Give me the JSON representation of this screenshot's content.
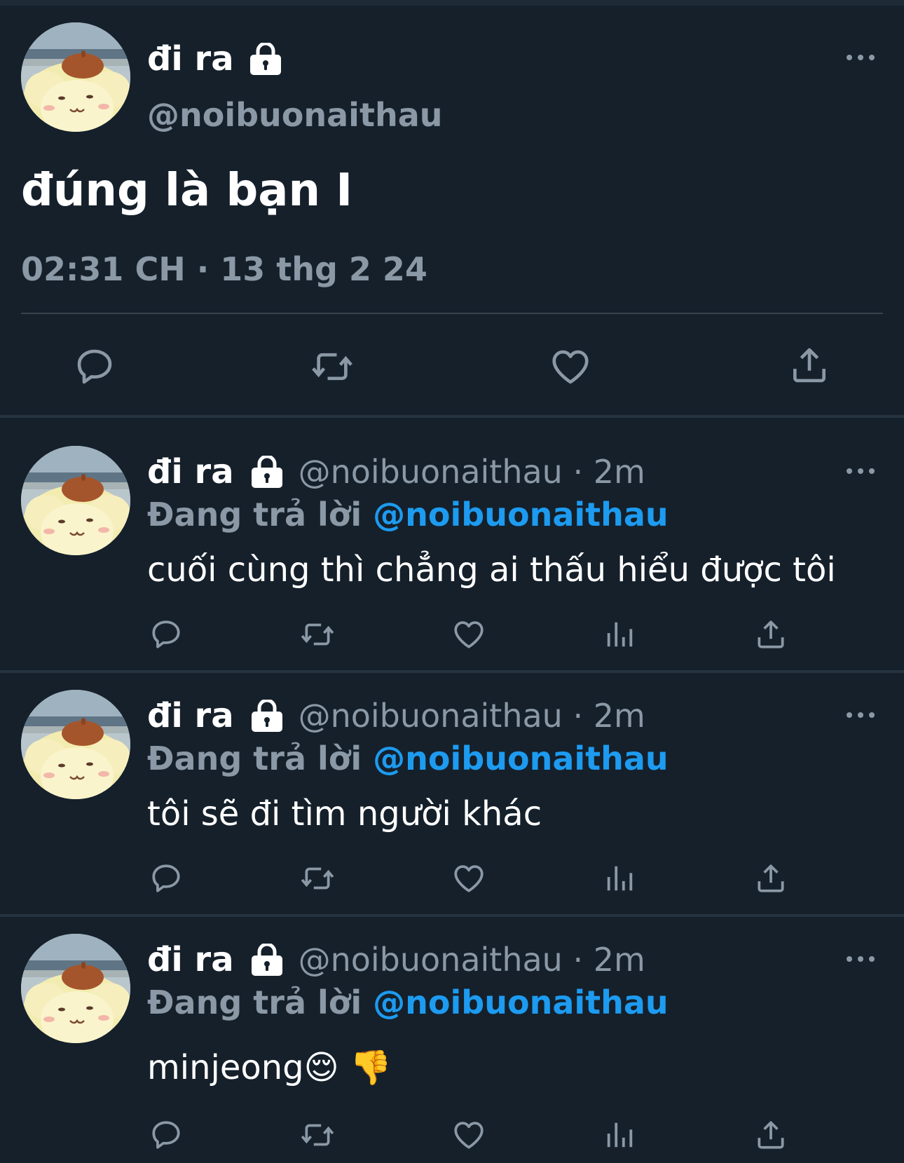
{
  "main_tweet": {
    "display_name": "đi ra",
    "handle": "@noibuonaithau",
    "text": "đúng là bạn I",
    "timestamp": "02:31 CH · 13 thg 2 24",
    "actions": [
      "reply-icon",
      "retweet-icon",
      "like-icon",
      "share-icon"
    ]
  },
  "replies": [
    {
      "display_name": "đi ra",
      "meta": "@noibuonaithau · 2m",
      "replying_prefix": "Đang trả lời ",
      "replying_to": "@noibuonaithau",
      "text": "cuối cùng thì chẳng ai thấu hiểu được tôi"
    },
    {
      "display_name": "đi ra",
      "meta": "@noibuonaithau · 2m",
      "replying_prefix": "Đang trả lời ",
      "replying_to": "@noibuonaithau",
      "text": "tôi sẽ đi tìm người khác"
    },
    {
      "display_name": "đi ra",
      "meta": "@noibuonaithau · 2m",
      "replying_prefix": "Đang trả lời ",
      "replying_to": "@noibuonaithau",
      "text": "minjeong😌 👎"
    }
  ],
  "colors": {
    "background": "#15202b",
    "secondary_text": "#8b98a5",
    "accent": "#1d9bf0",
    "divider": "#38444d"
  }
}
